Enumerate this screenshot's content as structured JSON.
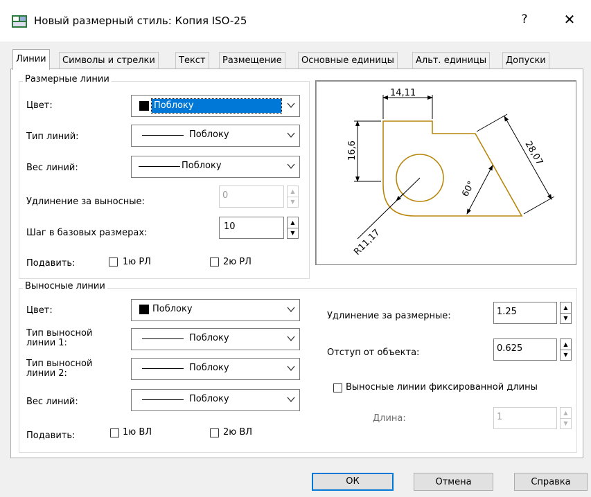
{
  "window": {
    "title": "Новый размерный стиль: Копия ISO-25",
    "help": "?",
    "close": "✕"
  },
  "tabs": [
    {
      "label": "Линии"
    },
    {
      "label": "Символы и стрелки"
    },
    {
      "label": "Текст"
    },
    {
      "label": "Размещение"
    },
    {
      "label": "Основные единицы"
    },
    {
      "label": "Альт. единицы"
    },
    {
      "label": "Допуски"
    }
  ],
  "dim_lines": {
    "group_title": "Размерные линии",
    "color_label": "Цвет:",
    "color_value": "Поблоку",
    "linetype_label": "Тип линий:",
    "linetype_value": "Поблоку",
    "lineweight_label": "Вес линий:",
    "lineweight_value": "Поблоку",
    "extend_label": "Удлинение за выносные:",
    "extend_value": "0",
    "baseline_label": "Шаг в базовых размерах:",
    "baseline_value": "10",
    "suppress_label": "Подавить:",
    "suppress_1": "1ю РЛ",
    "suppress_2": "2ю РЛ"
  },
  "ext_lines": {
    "group_title": "Выносные линии",
    "color_label": "Цвет:",
    "color_value": "Поблоку",
    "linetype1_label_a": "Тип выносной",
    "linetype1_label_b": "линии 1:",
    "linetype1_value": "Поблоку",
    "linetype2_label_a": "Тип выносной",
    "linetype2_label_b": "линии 2:",
    "linetype2_value": "Поблоку",
    "lineweight_label": "Вес линий:",
    "lineweight_value": "Поблоку",
    "suppress_label": "Подавить:",
    "suppress_1": "1ю ВЛ",
    "suppress_2": "2ю ВЛ",
    "extend_beyond_label": "Удлинение за размерные:",
    "extend_beyond_value": "1.25",
    "offset_label": "Отступ от объекта:",
    "offset_value": "0.625",
    "fixed_length_label": "Выносные линии фиксированной длины",
    "length_label": "Длина:",
    "length_value": "1"
  },
  "preview": {
    "dim_top": "14,11",
    "dim_left": "16,6",
    "dim_diag": "28,07",
    "dim_angle": "60°",
    "dim_radius": "R11,17",
    "part_color": "#b8860b"
  },
  "buttons": {
    "ok": "ОК",
    "cancel": "Отмена",
    "help": "Справка"
  },
  "colors": {
    "accent": "#0078d7",
    "swatch": "#000000"
  }
}
